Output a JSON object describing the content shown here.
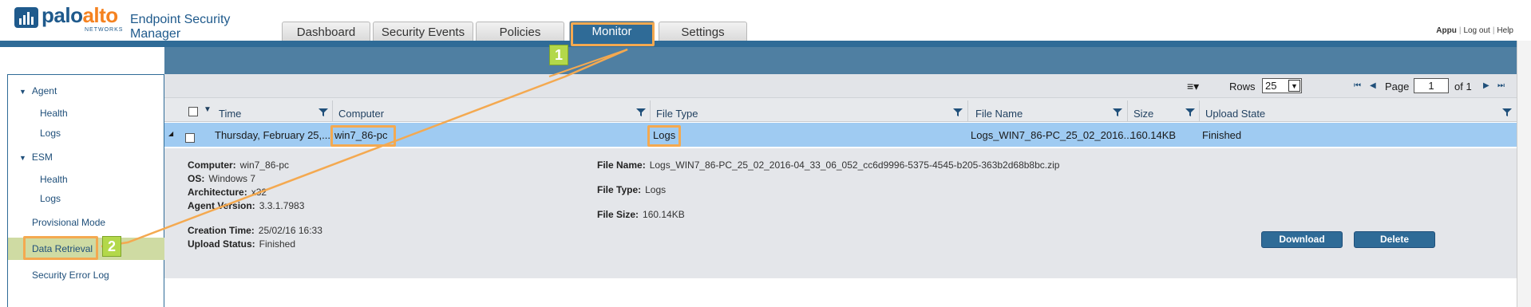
{
  "header": {
    "brand_palo": "palo",
    "brand_alto": "alto",
    "brand_networks": "NETWORKS",
    "product": "Endpoint Security Manager"
  },
  "tabs": [
    {
      "label": "Dashboard"
    },
    {
      "label": "Security Events"
    },
    {
      "label": "Policies"
    },
    {
      "label": "Monitor",
      "active": true
    },
    {
      "label": "Settings"
    }
  ],
  "user": {
    "name": "Appu",
    "logout": "Log out",
    "help": "Help",
    "sep": "|"
  },
  "sidebar": {
    "agent": {
      "label": "Agent",
      "items": [
        {
          "label": "Health"
        },
        {
          "label": "Logs"
        }
      ]
    },
    "esm": {
      "label": "ESM",
      "items": [
        {
          "label": "Health"
        },
        {
          "label": "Logs"
        }
      ]
    },
    "provisional": "Provisional Mode",
    "data_retrieval": "Data Retrieval",
    "security_error_log": "Security Error Log"
  },
  "toolbar": {
    "rows_label": "Rows",
    "rows_value": "25",
    "page_label": "Page",
    "page_value": "1",
    "of_label": "of 1"
  },
  "columns": [
    "Time",
    "Computer",
    "File Type",
    "File Name",
    "Size",
    "Upload State"
  ],
  "row": {
    "time": "Thursday, February 25,...",
    "computer": "win7_86-pc",
    "file_type": "Logs",
    "file_name": "Logs_WIN7_86-PC_25_02_2016...",
    "size": "160.14KB",
    "upload_state": "Finished"
  },
  "detail": {
    "computer_label": "Computer:",
    "computer": "win7_86-pc",
    "os_label": "OS:",
    "os": "Windows 7",
    "arch_label": "Architecture:",
    "arch": "x32",
    "agent_label": "Agent Version:",
    "agent": "3.3.1.7983",
    "creation_label": "Creation Time:",
    "creation": "25/02/16 16:33",
    "upload_label": "Upload Status:",
    "upload": "Finished",
    "file_name_label": "File Name:",
    "file_name": "Logs_WIN7_86-PC_25_02_2016-04_33_06_052_cc6d9996-5375-4545-b205-363b2d68b8bc.zip",
    "file_type_label": "File Type:",
    "file_type": "Logs",
    "file_size_label": "File Size:",
    "file_size": "160.14KB"
  },
  "buttons": {
    "download": "Download",
    "delete": "Delete"
  },
  "annotations": {
    "one": "1",
    "two": "2"
  },
  "colors": {
    "accent": "#2f6b97",
    "highlight": "#f4a950",
    "marker": "#b3d84a",
    "selected_row": "#9fcbf2"
  }
}
